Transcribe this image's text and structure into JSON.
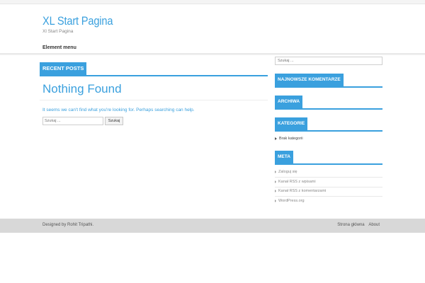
{
  "header": {
    "site_title": "XL Start Pagina",
    "site_description": "Xl Start Pagina",
    "menu_label": "Element menu"
  },
  "main": {
    "section_title": "RECENT POSTS",
    "heading": "Nothing Found",
    "message": "It seems we can't find what you're looking for. Perhaps searching can help.",
    "search_placeholder": "Szukaj ...",
    "search_button": "Szukaj"
  },
  "sidebar": {
    "search_placeholder": "Szukaj ...",
    "widgets": {
      "comments_title": "NAJNOWSZE KOMENTARZE",
      "archives_title": "ARCHIWA",
      "categories_title": "KATEGORIE",
      "categories_items": [
        "Brak kategorii"
      ],
      "meta_title": "META",
      "meta_items": [
        "Zaloguj się",
        "Kanał RSS z wpisami",
        "Kanał RSS z komentarzami",
        "WordPress.org"
      ]
    }
  },
  "footer": {
    "designed_by_prefix": "Designed by",
    "designer": "Rohit Tripathi.",
    "links": [
      "Strona główna",
      "About"
    ]
  },
  "colors": {
    "accent": "#3aa0de",
    "footer_bg": "#d8d8d8"
  }
}
